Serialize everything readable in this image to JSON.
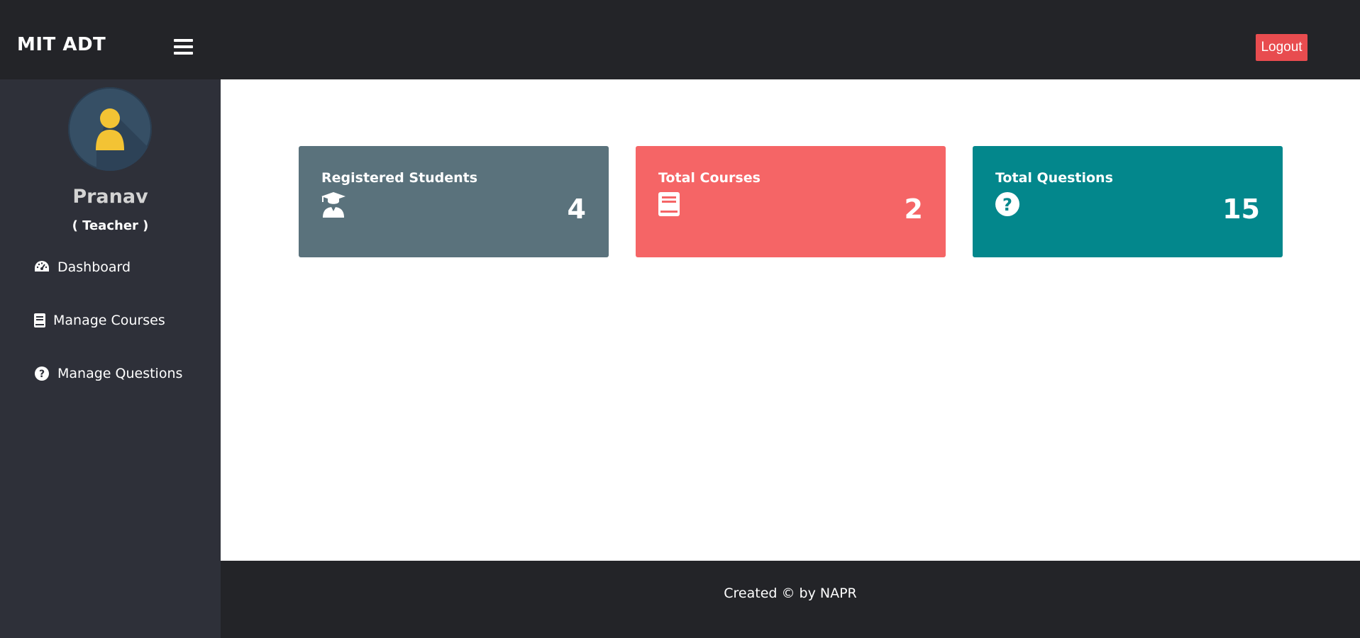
{
  "header": {
    "brand": "MIT ADT",
    "menu_icon": "hamburger-icon",
    "logout_label": "Logout",
    "logout_color": "#e84c4f"
  },
  "sidebar": {
    "avatar_icon": "user-avatar-icon",
    "user_name": "Pranav",
    "user_role": "( Teacher )",
    "items": [
      {
        "label": "Dashboard",
        "icon": "tachometer-icon"
      },
      {
        "label": "Manage Courses",
        "icon": "book-icon"
      },
      {
        "label": "Manage Questions",
        "icon": "question-circle-icon"
      }
    ]
  },
  "cards": [
    {
      "label": "Registered Students",
      "value": "4",
      "icon": "user-graduate-icon",
      "color": "#5a727c"
    },
    {
      "label": "Total Courses",
      "value": "2",
      "icon": "book-icon",
      "color": "#f56566"
    },
    {
      "label": "Total Questions",
      "value": "15",
      "icon": "question-circle-icon",
      "color": "#03878c"
    }
  ],
  "footer": {
    "text": "Created © by NAPR"
  }
}
